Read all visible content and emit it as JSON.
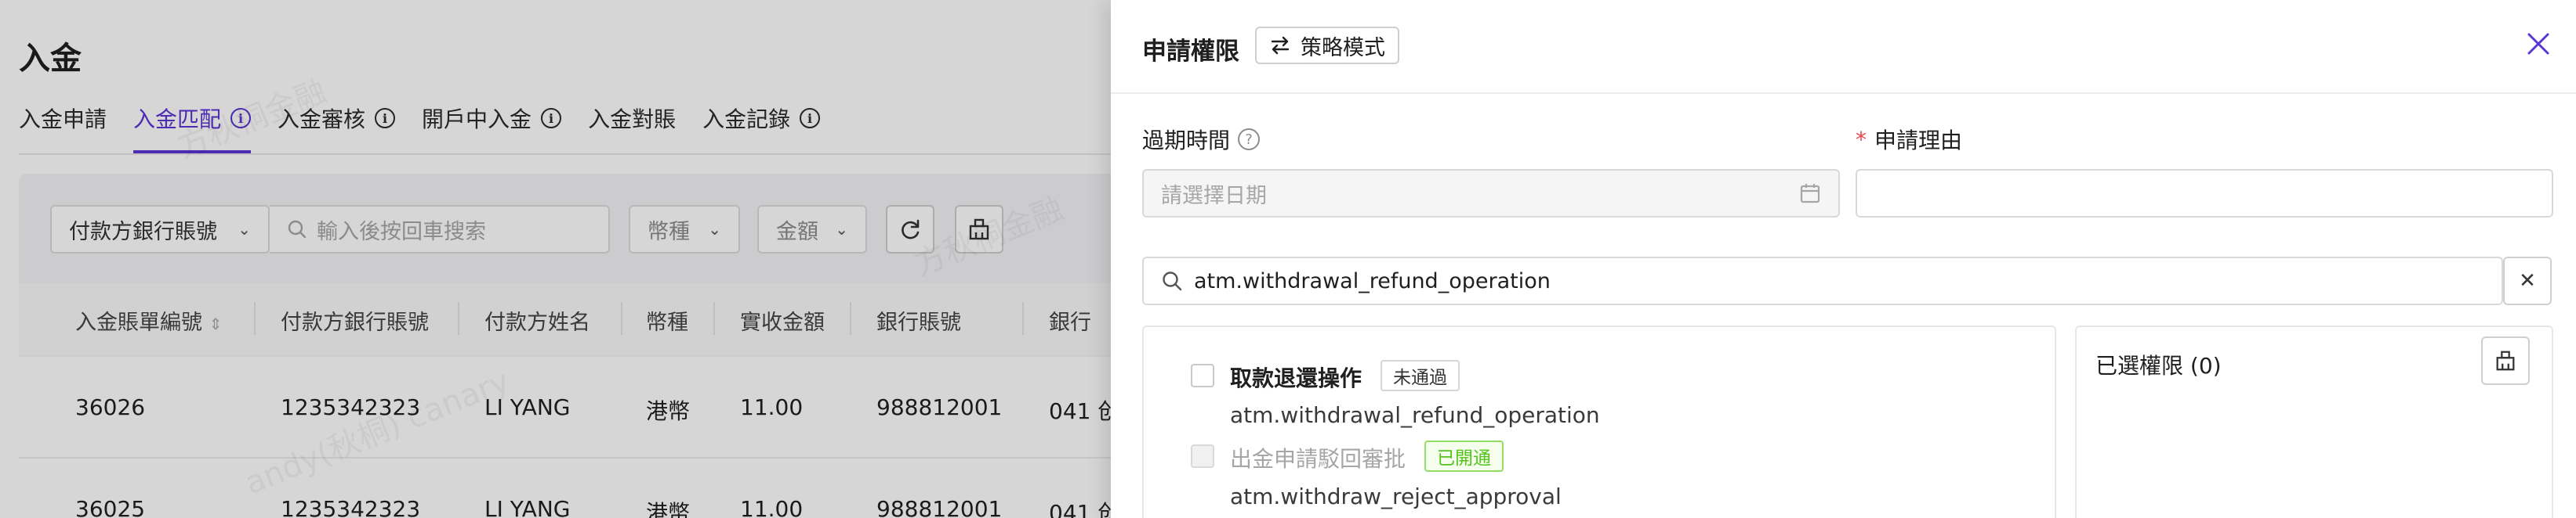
{
  "page": {
    "title": "入金",
    "tabs": [
      {
        "label": "入金申請",
        "info": false
      },
      {
        "label": "入金匹配",
        "info": true
      },
      {
        "label": "入金審核",
        "info": true
      },
      {
        "label": "開戶中入金",
        "info": true
      },
      {
        "label": "入金對賬",
        "info": false
      },
      {
        "label": "入金記錄",
        "info": true
      }
    ],
    "filters": {
      "account_select": "付款方銀行賬號",
      "search_placeholder": "輸入後按回車搜索",
      "currency_select": "幣種",
      "amount_select": "金額"
    },
    "table": {
      "headers": [
        "入金賬單編號",
        "付款方銀行賬號",
        "付款方姓名",
        "幣種",
        "實收金額",
        "銀行賬號",
        "銀行"
      ],
      "rows": [
        [
          "36026",
          "1235342323",
          "LI YANG",
          "港幣",
          "11.00",
          "988812001",
          "041 创"
        ],
        [
          "36025",
          "1235342323",
          "LI YANG",
          "港幣",
          "11.00",
          "988812001",
          "041 创"
        ]
      ]
    },
    "watermarks": [
      "方秋桐金融",
      "andy(秋桐) canary",
      "方秋桐金融"
    ]
  },
  "drawer": {
    "title": "申請權限",
    "strategy_button": "策略模式",
    "expire_label": "過期時間",
    "date_placeholder": "請選擇日期",
    "reason_label": "申請理由",
    "reason_value": "",
    "search_value": "atm.withdrawal_refund_operation",
    "permissions": [
      {
        "name": "取款退還操作",
        "code": "atm.withdrawal_refund_operation",
        "status": "未通過",
        "status_color": "#333333",
        "disabled": false
      },
      {
        "name": "出金申請駁回審批",
        "code": "atm.withdraw_reject_approval",
        "status": "已開通",
        "status_color": "#52c41a",
        "disabled": true
      }
    ],
    "selected_title": "已選權限 (0)"
  },
  "colors": {
    "accent": "#5b35d5",
    "required": "#e5484d",
    "success": "#52c41a"
  }
}
